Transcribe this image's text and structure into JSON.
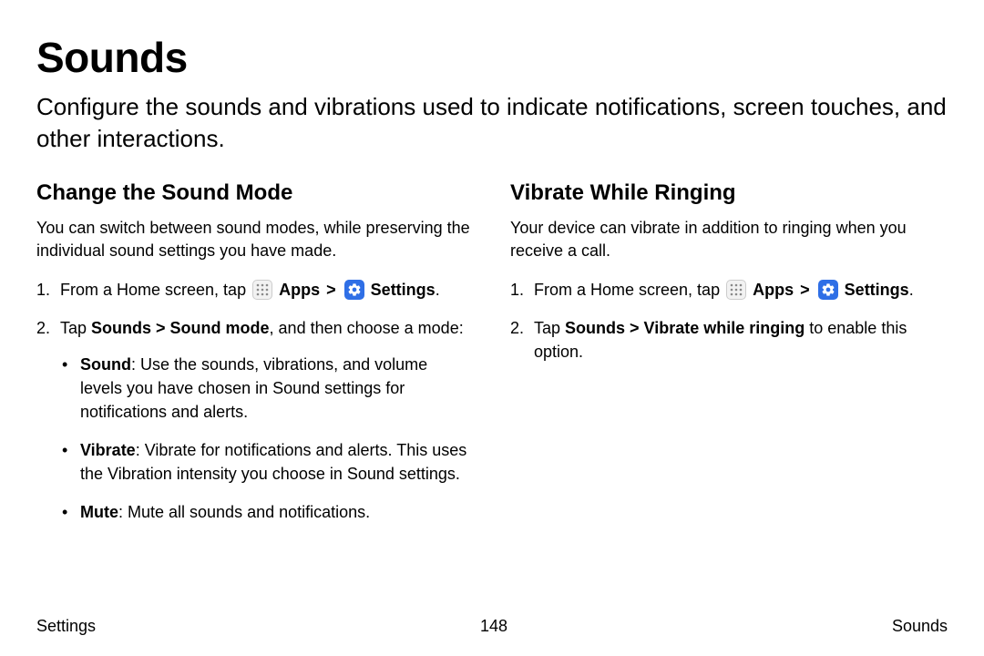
{
  "title": "Sounds",
  "intro": "Configure the sounds and vibrations used to indicate notifications, screen touches, and other interactions.",
  "left": {
    "heading": "Change the Sound Mode",
    "desc": "You can switch between sound modes, while preserving the individual sound settings you have made.",
    "step1_pre": "From a Home screen, tap",
    "apps_label": "Apps",
    "chevron": ">",
    "settings_label": "Settings",
    "step1_post": ".",
    "step2_pre": "Tap ",
    "step2_bold": "Sounds > Sound mode",
    "step2_post": ", and then choose a mode:",
    "bullets": [
      {
        "bold": "Sound",
        "text": ": Use the sounds, vibrations, and volume levels you have chosen in Sound settings for notifications and alerts."
      },
      {
        "bold": "Vibrate",
        "text": ": Vibrate for notifications and alerts. This uses the Vibration intensity you choose in Sound settings."
      },
      {
        "bold": "Mute",
        "text": ": Mute all sounds and notifications."
      }
    ]
  },
  "right": {
    "heading": "Vibrate While Ringing",
    "desc": "Your device can vibrate in addition to ringing when you receive a call.",
    "step1_pre": "From a Home screen, tap",
    "apps_label": "Apps",
    "chevron": ">",
    "settings_label": "Settings",
    "step1_post": ".",
    "step2_pre": "Tap ",
    "step2_bold": "Sounds > Vibrate while ringing",
    "step2_post": " to enable this option."
  },
  "footer": {
    "left": "Settings",
    "center": "148",
    "right": "Sounds"
  }
}
